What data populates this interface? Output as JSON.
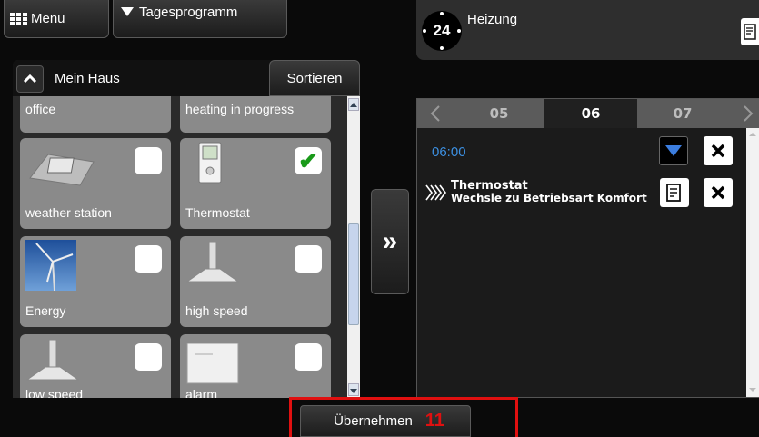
{
  "topbar": {
    "menu_label": "Menu",
    "program_label": "Tagesprogramm",
    "heizung_badge": "24",
    "heizung_label": "Heizung"
  },
  "house_panel": {
    "title": "Mein Haus",
    "sort_label": "Sortieren",
    "partial_top": [
      "office",
      "heating in progress"
    ],
    "tiles": [
      {
        "label": "weather station",
        "checked": false,
        "icon": "weather-station-icon"
      },
      {
        "label": "Thermostat",
        "checked": true,
        "icon": "thermostat-icon"
      },
      {
        "label": "Energy",
        "checked": false,
        "icon": "wind-turbine-icon"
      },
      {
        "label": "high speed",
        "checked": false,
        "icon": "extractor-hood-icon"
      },
      {
        "label": "low speed",
        "checked": false,
        "icon": "extractor-hood-icon"
      },
      {
        "label": "alarm",
        "checked": false,
        "icon": "alarm-panel-icon"
      }
    ],
    "checkmark": "✔"
  },
  "transfer_glyph": "»",
  "schedule": {
    "tabs": [
      "05",
      "06",
      "07"
    ],
    "active_tab": "06",
    "time": "06:00",
    "entry_title": "Thermostat",
    "entry_subtitle": "Wechsle zu Betriebsart Komfort"
  },
  "footer": {
    "apply_label": "Übernehmen",
    "count": "11"
  },
  "colors": {
    "tile_bg": "#8a8a8a",
    "time_blue": "#3c8fe0",
    "highlight_red": "#e01010",
    "count_red": "#e01010"
  }
}
